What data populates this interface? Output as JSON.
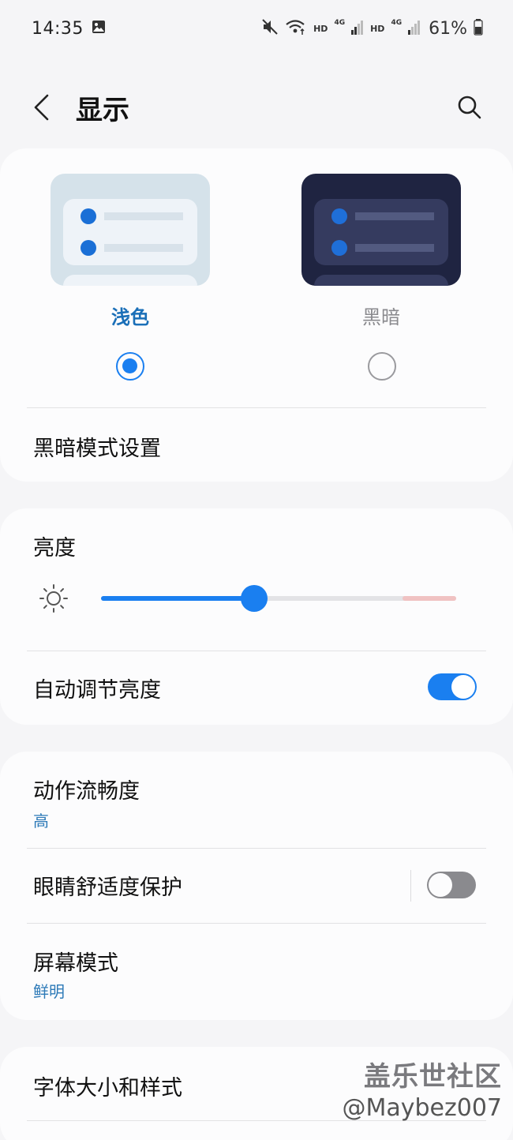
{
  "status_bar": {
    "time": "14:35",
    "hd_1": "HD",
    "net_1": "4G",
    "hd_2": "HD",
    "net_2": "4G",
    "battery": "61%"
  },
  "header": {
    "title": "显示"
  },
  "theme": {
    "light_label": "浅色",
    "dark_label": "黑暗",
    "selected": "light",
    "dark_mode_settings": "黑暗模式设置"
  },
  "brightness": {
    "title": "亮度",
    "level": 0.43,
    "auto_label": "自动调节亮度",
    "auto_enabled": true
  },
  "motion": {
    "title": "动作流畅度",
    "value": "高",
    "eye_comfort_label": "眼睛舒适度保护",
    "eye_comfort_enabled": false,
    "screen_mode_title": "屏幕模式",
    "screen_mode_value": "鲜明"
  },
  "font": {
    "title": "字体大小和样式"
  },
  "watermark": {
    "line1": "盖乐世社区",
    "line2": "@Maybez007"
  },
  "colors": {
    "accent": "#1a7ff0",
    "subtext": "#2d7ab8",
    "background": "#f5f5f7",
    "card": "#fcfcfd"
  }
}
